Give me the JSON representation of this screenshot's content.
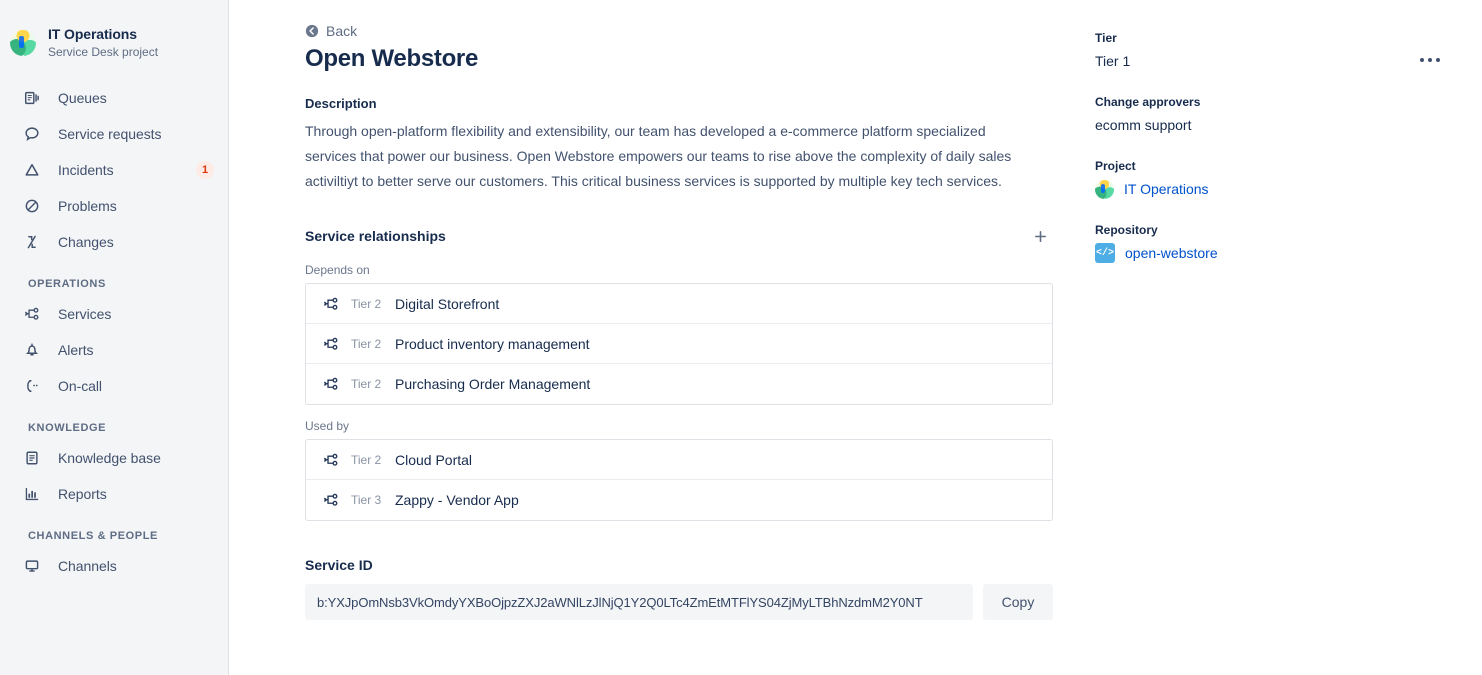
{
  "sidebar": {
    "project": {
      "name": "IT Operations",
      "subtitle": "Service Desk project",
      "avatar_icon": "project-avatar-icon"
    },
    "primary_items": [
      {
        "label": "Queues",
        "icon": "queues-icon",
        "badge": ""
      },
      {
        "label": "Service requests",
        "icon": "chat-bubble-icon",
        "badge": ""
      },
      {
        "label": "Incidents",
        "icon": "warning-triangle-icon",
        "badge": "1"
      },
      {
        "label": "Problems",
        "icon": "no-entry-icon",
        "badge": ""
      },
      {
        "label": "Changes",
        "icon": "changes-arrows-icon",
        "badge": ""
      }
    ],
    "sections": [
      {
        "title": "OPERATIONS",
        "items": [
          {
            "label": "Services",
            "icon": "sitemap-icon",
            "badge": ""
          },
          {
            "label": "Alerts",
            "icon": "bell-icon",
            "badge": ""
          },
          {
            "label": "On-call",
            "icon": "phone-icon",
            "badge": ""
          }
        ]
      },
      {
        "title": "KNOWLEDGE",
        "items": [
          {
            "label": "Knowledge base",
            "icon": "book-icon",
            "badge": ""
          },
          {
            "label": "Reports",
            "icon": "bar-chart-icon",
            "badge": ""
          }
        ]
      },
      {
        "title": "CHANNELS & PEOPLE",
        "items": [
          {
            "label": "Channels",
            "icon": "monitor-icon",
            "badge": ""
          }
        ]
      }
    ]
  },
  "header": {
    "back_label": "Back",
    "back_icon": "back-circle-arrow-icon",
    "title": "Open Webstore",
    "more_icon": "more-horizontal-icon"
  },
  "description": {
    "label": "Description",
    "text": "Through open-platform flexibility and extensibility, our team has developed a e-commerce platform specialized services that power our business. Open Webstore empowers our teams to rise above the complexity of daily sales activiltiyt to better serve our customers. This critical business services is supported by multiple key tech services."
  },
  "relationships": {
    "title": "Service relationships",
    "add_icon": "plus-icon",
    "groups": [
      {
        "label": "Depends on",
        "rows": [
          {
            "tier": "Tier 2",
            "name": "Digital Storefront",
            "icon": "sitemap-icon"
          },
          {
            "tier": "Tier 2",
            "name": "Product inventory management",
            "icon": "sitemap-icon"
          },
          {
            "tier": "Tier 2",
            "name": "Purchasing Order Management",
            "icon": "sitemap-icon"
          }
        ]
      },
      {
        "label": "Used by",
        "rows": [
          {
            "tier": "Tier 2",
            "name": "Cloud Portal",
            "icon": "sitemap-icon"
          },
          {
            "tier": "Tier 3",
            "name": "Zappy - Vendor App",
            "icon": "sitemap-icon"
          }
        ]
      }
    ]
  },
  "service_id": {
    "title": "Service ID",
    "value": "b:YXJpOmNsb3VkOmdyYXBoOjpzZXJ2aWNlLzJlNjQ1Y2Q0LTc4ZmEtMTFlYS04ZjMyLTBhNzdmM2Y0NT",
    "copy_label": "Copy"
  },
  "details": {
    "tier": {
      "label": "Tier",
      "value": "Tier 1"
    },
    "change_approvers": {
      "label": "Change approvers",
      "value": "ecomm support"
    },
    "project": {
      "label": "Project",
      "value": "IT Operations",
      "icon": "project-avatar-icon"
    },
    "repository": {
      "label": "Repository",
      "value": "open-webstore",
      "icon": "code-brackets-icon",
      "icon_glyph": "</>"
    }
  },
  "colors": {
    "link": "#0052CC",
    "text_primary": "#172B4D",
    "text_muted": "#5E6C84",
    "badge_bg": "#FFEBE6",
    "badge_fg": "#DE350B",
    "sidebar_bg": "#F4F5F7",
    "repo_icon_bg": "#4FADE6"
  }
}
